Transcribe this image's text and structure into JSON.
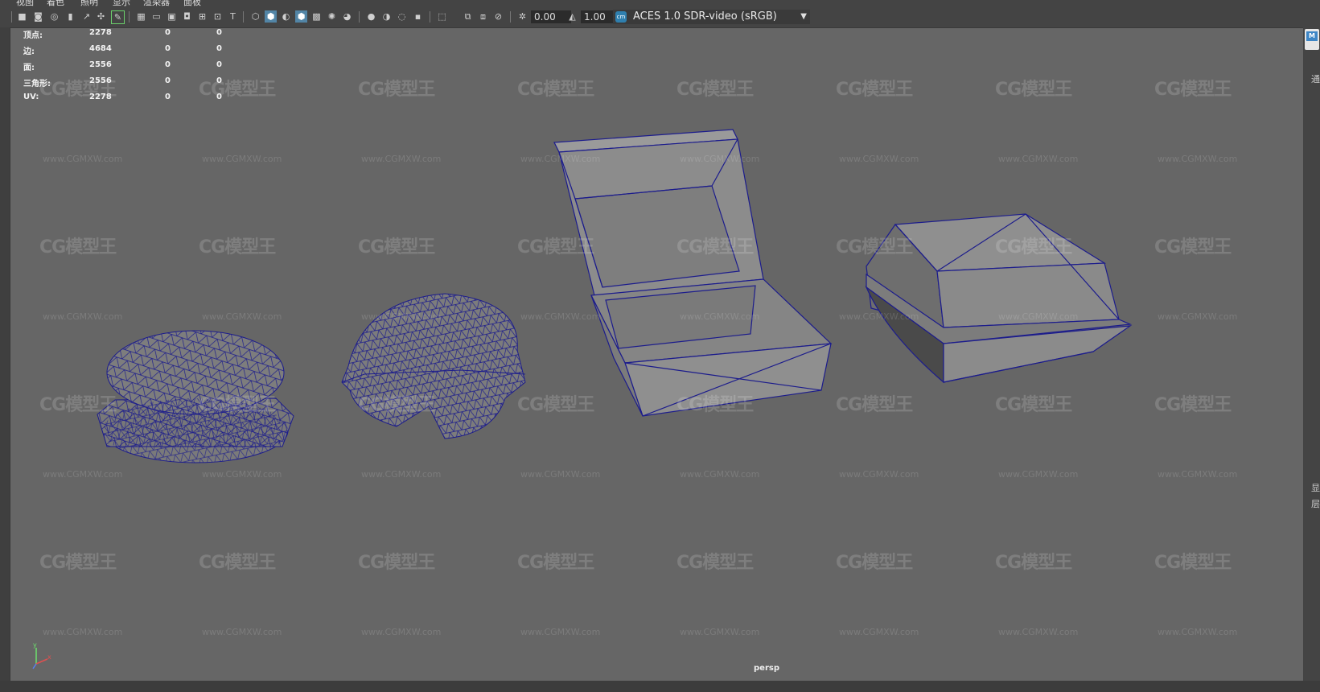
{
  "menu": [
    "视图",
    "着色",
    "照明",
    "显示",
    "渲染器",
    "面板"
  ],
  "toolbar": {
    "exposure": "0.00",
    "gamma": "1.00",
    "colorspace_icon": "cm",
    "colorspace": "ACES 1.0 SDR-video (sRGB)"
  },
  "hud": {
    "rows": [
      {
        "label": "顶点:",
        "v1": "2278",
        "v2": "0",
        "v3": "0"
      },
      {
        "label": "边:",
        "v1": "4684",
        "v2": "0",
        "v3": "0"
      },
      {
        "label": "面:",
        "v1": "2556",
        "v2": "0",
        "v3": "0"
      },
      {
        "label": "三角形:",
        "v1": "2556",
        "v2": "0",
        "v3": "0"
      },
      {
        "label": "UV:",
        "v1": "2278",
        "v2": "0",
        "v3": "0"
      }
    ]
  },
  "viewport": {
    "camera": "persp",
    "watermark_logo": "CG模型王",
    "watermark_url": "www.CGMXW.com"
  },
  "axis": {
    "y": "y",
    "x": "x"
  },
  "side": {
    "tab": "M",
    "char1": "通",
    "char2": "显",
    "char3": "层"
  },
  "colors": {
    "viewport_bg": "#666666",
    "wireframe": "#1c1c8c",
    "accent": "#5285a6"
  }
}
